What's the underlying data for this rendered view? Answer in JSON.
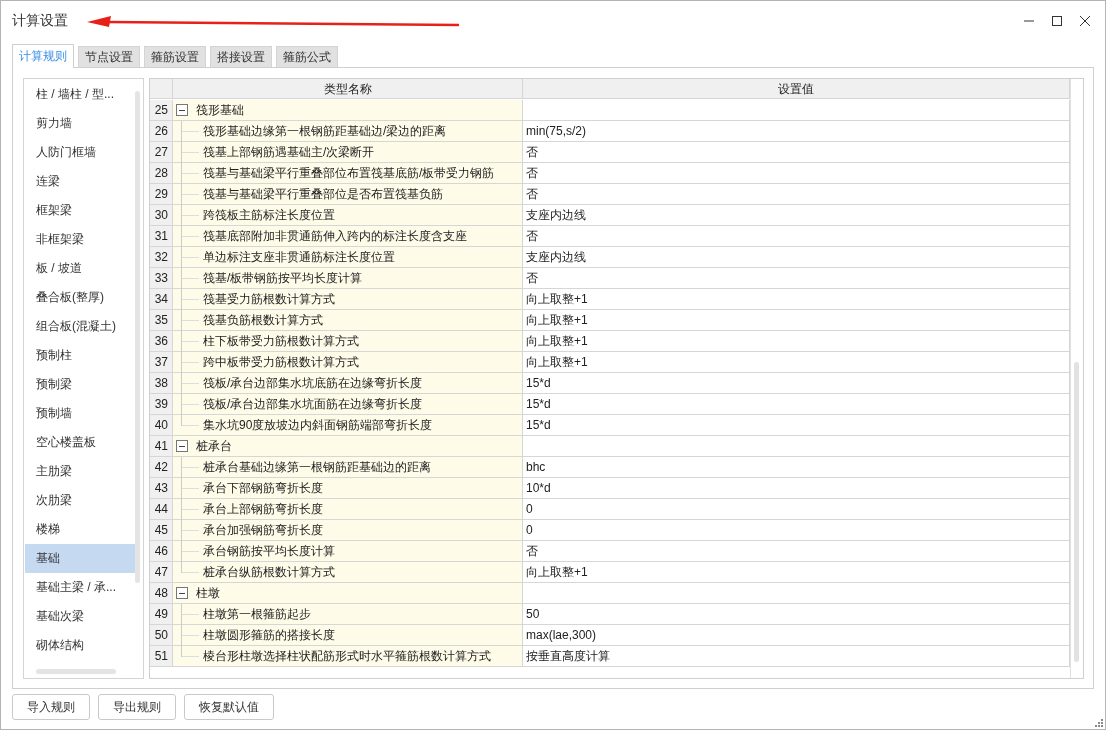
{
  "window": {
    "title": "计算设置"
  },
  "tabs": [
    {
      "label": "计算规则",
      "selected": true
    },
    {
      "label": "节点设置",
      "selected": false
    },
    {
      "label": "箍筋设置",
      "selected": false
    },
    {
      "label": "搭接设置",
      "selected": false
    },
    {
      "label": "箍筋公式",
      "selected": false
    }
  ],
  "sidebar": {
    "items": [
      {
        "label": "柱 / 墙柱 / 型...",
        "selected": false
      },
      {
        "label": "剪力墙",
        "selected": false
      },
      {
        "label": "人防门框墙",
        "selected": false
      },
      {
        "label": "连梁",
        "selected": false
      },
      {
        "label": "框架梁",
        "selected": false
      },
      {
        "label": "非框架梁",
        "selected": false
      },
      {
        "label": "板 / 坡道",
        "selected": false
      },
      {
        "label": "叠合板(整厚)",
        "selected": false
      },
      {
        "label": "组合板(混凝土)",
        "selected": false
      },
      {
        "label": "预制柱",
        "selected": false
      },
      {
        "label": "预制梁",
        "selected": false
      },
      {
        "label": "预制墙",
        "selected": false
      },
      {
        "label": "空心楼盖板",
        "selected": false
      },
      {
        "label": "主肋梁",
        "selected": false
      },
      {
        "label": "次肋梁",
        "selected": false
      },
      {
        "label": "楼梯",
        "selected": false
      },
      {
        "label": "基础",
        "selected": true
      },
      {
        "label": "基础主梁 / 承...",
        "selected": false
      },
      {
        "label": "基础次梁",
        "selected": false
      },
      {
        "label": "砌体结构",
        "selected": false
      }
    ]
  },
  "table": {
    "columns": [
      "类型名称",
      "设置值"
    ],
    "rows": [
      {
        "number": "25",
        "name": "筏形基础",
        "expanded": true,
        "children": [
          {
            "number": "26",
            "name": "筏形基础边缘第一根钢筋距基础边/梁边的距离",
            "value": "min(75,s/2)"
          },
          {
            "number": "27",
            "name": "筏基上部钢筋遇基础主/次梁断开",
            "value": "否"
          },
          {
            "number": "28",
            "name": "筏基与基础梁平行重叠部位布置筏基底筋/板带受力钢筋",
            "value": "否"
          },
          {
            "number": "29",
            "name": "筏基与基础梁平行重叠部位是否布置筏基负筋",
            "value": "否"
          },
          {
            "number": "30",
            "name": "跨筏板主筋标注长度位置",
            "value": "支座内边线"
          },
          {
            "number": "31",
            "name": "筏基底部附加非贯通筋伸入跨内的标注长度含支座",
            "value": "否"
          },
          {
            "number": "32",
            "name": "单边标注支座非贯通筋标注长度位置",
            "value": "支座内边线"
          },
          {
            "number": "33",
            "name": "筏基/板带钢筋按平均长度计算",
            "value": "否"
          },
          {
            "number": "34",
            "name": "筏基受力筋根数计算方式",
            "value": "向上取整+1"
          },
          {
            "number": "35",
            "name": "筏基负筋根数计算方式",
            "value": "向上取整+1"
          },
          {
            "number": "36",
            "name": "柱下板带受力筋根数计算方式",
            "value": "向上取整+1"
          },
          {
            "number": "37",
            "name": "跨中板带受力筋根数计算方式",
            "value": "向上取整+1"
          },
          {
            "number": "38",
            "name": "筏板/承台边部集水坑底筋在边缘弯折长度",
            "value": "15*d"
          },
          {
            "number": "39",
            "name": "筏板/承台边部集水坑面筋在边缘弯折长度",
            "value": "15*d"
          },
          {
            "number": "40",
            "name": "集水坑90度放坡边内斜面钢筋端部弯折长度",
            "value": "15*d"
          }
        ]
      },
      {
        "number": "41",
        "name": "桩承台",
        "expanded": true,
        "children": [
          {
            "number": "42",
            "name": "桩承台基础边缘第一根钢筋距基础边的距离",
            "value": "bhc"
          },
          {
            "number": "43",
            "name": "承台下部钢筋弯折长度",
            "value": "10*d"
          },
          {
            "number": "44",
            "name": "承台上部钢筋弯折长度",
            "value": "0"
          },
          {
            "number": "45",
            "name": "承台加强钢筋弯折长度",
            "value": "0"
          },
          {
            "number": "46",
            "name": "承台钢筋按平均长度计算",
            "value": "否"
          },
          {
            "number": "47",
            "name": "桩承台纵筋根数计算方式",
            "value": "向上取整+1"
          }
        ]
      },
      {
        "number": "48",
        "name": "柱墩",
        "expanded": true,
        "children": [
          {
            "number": "49",
            "name": "柱墩第一根箍筋起步",
            "value": "50"
          },
          {
            "number": "50",
            "name": "柱墩圆形箍筋的搭接长度",
            "value": "max(lae,300)"
          },
          {
            "number": "51",
            "name": "棱台形柱墩选择柱状配筋形式时水平箍筋根数计算方式",
            "value": "按垂直高度计算"
          }
        ]
      }
    ]
  },
  "buttons": [
    "导入规则",
    "导出规则",
    "恢复默认值"
  ]
}
